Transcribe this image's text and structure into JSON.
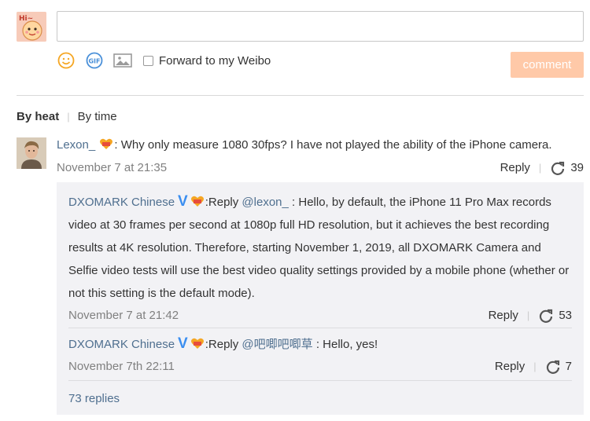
{
  "compose": {
    "forward_label": "Forward to my Weibo",
    "comment_button": "comment",
    "my_avatar_text": "Hi~"
  },
  "icons": [
    "smiley-icon",
    "gif-icon",
    "image-icon"
  ],
  "sort": {
    "active": "By heat",
    "other": "By time"
  },
  "comment": {
    "user": "Lexon_",
    "text": ": Why only measure 1080 30fps? I have not played the ability of the iPhone camera.",
    "time": "November 7 at 21:35",
    "reply": "Reply",
    "reposts": "39"
  },
  "replies": [
    {
      "user": "DXOMARK Chinese",
      "prefix": ":Reply ",
      "mention": "@lexon_",
      "text": " : Hello, by default, the iPhone 11 Pro Max records video at 30 frames per second at 1080p full HD resolution, but it achieves the best recording results at 4K resolution. Therefore, starting November 1, 2019, all DXOMARK Camera and Selfie video tests will use the best video quality settings provided by a mobile phone (whether or not this setting is the default mode).",
      "time": "November 7 at 21:42",
      "reply": "Reply",
      "reposts": "53"
    },
    {
      "user": "DXOMARK Chinese",
      "prefix": ":Reply ",
      "mention": "@吧唧吧唧草",
      "text": " : Hello, yes!",
      "time": "November 7th 22:11",
      "reply": "Reply",
      "reposts": "7"
    }
  ],
  "more_replies": "73 replies",
  "colors": {
    "accent_button": "#ffc9a8",
    "link": "#4f6f8f",
    "verified": "#3a8ef0",
    "reply_bg": "#f2f2f5"
  }
}
